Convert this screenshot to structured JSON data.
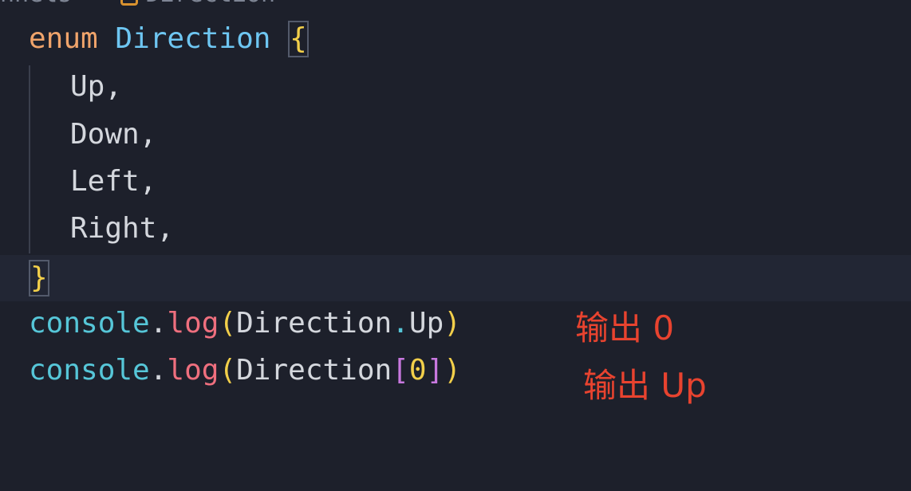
{
  "breadcrumb": {
    "left": "nnels",
    "separator": ">",
    "file_icon": "symbol-enum-icon",
    "current": "Direction"
  },
  "code": {
    "enum_keyword": "enum",
    "enum_name": "Direction",
    "open_brace": "{",
    "members": [
      "Up,",
      "Down,",
      "Left,",
      "Right,"
    ],
    "close_brace": "}",
    "line1": {
      "obj": "console",
      "dot": ".",
      "fn": "log",
      "open": "(",
      "arg_obj": "Direction",
      "arg_dot": ".",
      "arg_prop": "Up",
      "close": ")"
    },
    "line2": {
      "obj": "console",
      "dot": ".",
      "fn": "log",
      "open": "(",
      "arg_obj": "Direction",
      "bracket_open": "[",
      "index": "0",
      "bracket_close": "]",
      "close": ")"
    }
  },
  "annotations": {
    "note1": "输出 0",
    "note2": "输出 Up"
  },
  "colors": {
    "background": "#1d202b",
    "keyword": "#f0a46b",
    "type": "#6ec6f2",
    "function": "#ef6f7e",
    "paren": "#f2cf4a",
    "bracket": "#c878df",
    "annotation": "#e8432f"
  }
}
